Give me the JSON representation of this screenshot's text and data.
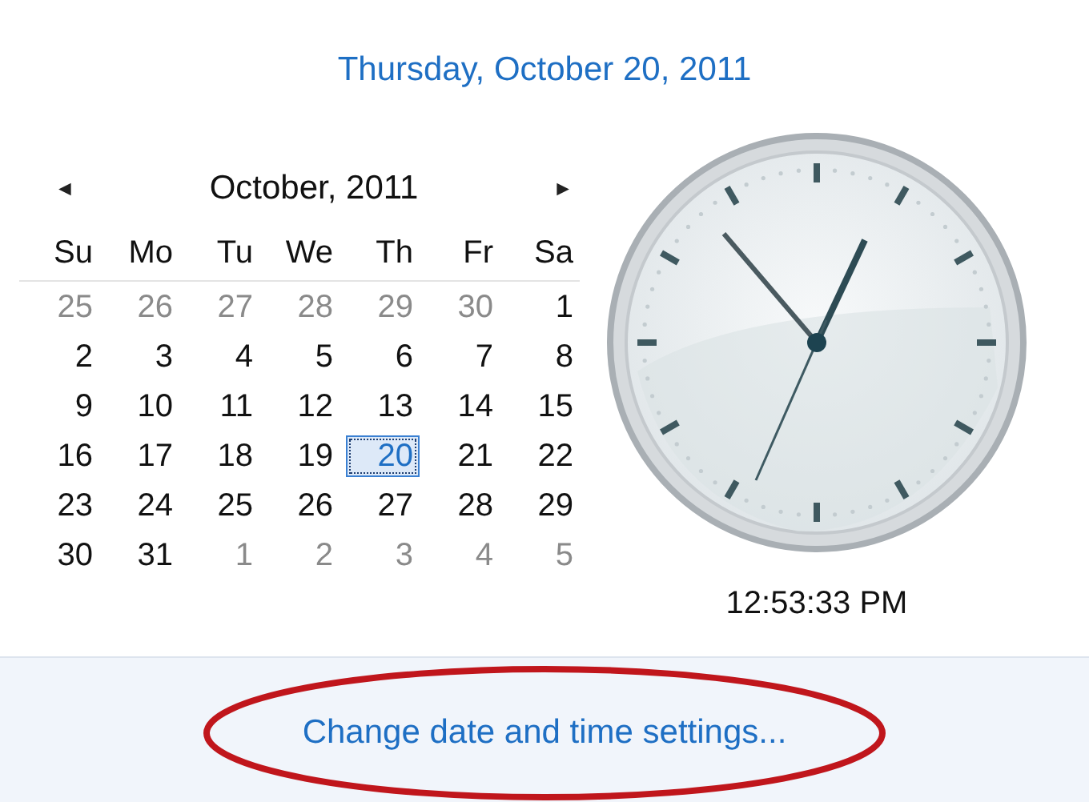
{
  "date_heading": "Thursday, October 20, 2011",
  "calendar": {
    "prev": "◄",
    "month_title": "October, 2011",
    "next": "►",
    "weekdays": [
      "Su",
      "Mo",
      "Tu",
      "We",
      "Th",
      "Fr",
      "Sa"
    ],
    "days": [
      {
        "label": "25",
        "other_month": true,
        "selected": false
      },
      {
        "label": "26",
        "other_month": true,
        "selected": false
      },
      {
        "label": "27",
        "other_month": true,
        "selected": false
      },
      {
        "label": "28",
        "other_month": true,
        "selected": false
      },
      {
        "label": "29",
        "other_month": true,
        "selected": false
      },
      {
        "label": "30",
        "other_month": true,
        "selected": false
      },
      {
        "label": "1",
        "other_month": false,
        "selected": false
      },
      {
        "label": "2",
        "other_month": false,
        "selected": false
      },
      {
        "label": "3",
        "other_month": false,
        "selected": false
      },
      {
        "label": "4",
        "other_month": false,
        "selected": false
      },
      {
        "label": "5",
        "other_month": false,
        "selected": false
      },
      {
        "label": "6",
        "other_month": false,
        "selected": false
      },
      {
        "label": "7",
        "other_month": false,
        "selected": false
      },
      {
        "label": "8",
        "other_month": false,
        "selected": false
      },
      {
        "label": "9",
        "other_month": false,
        "selected": false
      },
      {
        "label": "10",
        "other_month": false,
        "selected": false
      },
      {
        "label": "11",
        "other_month": false,
        "selected": false
      },
      {
        "label": "12",
        "other_month": false,
        "selected": false
      },
      {
        "label": "13",
        "other_month": false,
        "selected": false
      },
      {
        "label": "14",
        "other_month": false,
        "selected": false
      },
      {
        "label": "15",
        "other_month": false,
        "selected": false
      },
      {
        "label": "16",
        "other_month": false,
        "selected": false
      },
      {
        "label": "17",
        "other_month": false,
        "selected": false
      },
      {
        "label": "18",
        "other_month": false,
        "selected": false
      },
      {
        "label": "19",
        "other_month": false,
        "selected": false
      },
      {
        "label": "20",
        "other_month": false,
        "selected": true
      },
      {
        "label": "21",
        "other_month": false,
        "selected": false
      },
      {
        "label": "22",
        "other_month": false,
        "selected": false
      },
      {
        "label": "23",
        "other_month": false,
        "selected": false
      },
      {
        "label": "24",
        "other_month": false,
        "selected": false
      },
      {
        "label": "25",
        "other_month": false,
        "selected": false
      },
      {
        "label": "26",
        "other_month": false,
        "selected": false
      },
      {
        "label": "27",
        "other_month": false,
        "selected": false
      },
      {
        "label": "28",
        "other_month": false,
        "selected": false
      },
      {
        "label": "29",
        "other_month": false,
        "selected": false
      },
      {
        "label": "30",
        "other_month": false,
        "selected": false
      },
      {
        "label": "31",
        "other_month": false,
        "selected": false
      },
      {
        "label": "1",
        "other_month": true,
        "selected": false
      },
      {
        "label": "2",
        "other_month": true,
        "selected": false
      },
      {
        "label": "3",
        "other_month": true,
        "selected": false
      },
      {
        "label": "4",
        "other_month": true,
        "selected": false
      },
      {
        "label": "5",
        "other_month": true,
        "selected": false
      }
    ]
  },
  "time": "12:53:33 PM",
  "settings_link": "Change date and time settings..."
}
